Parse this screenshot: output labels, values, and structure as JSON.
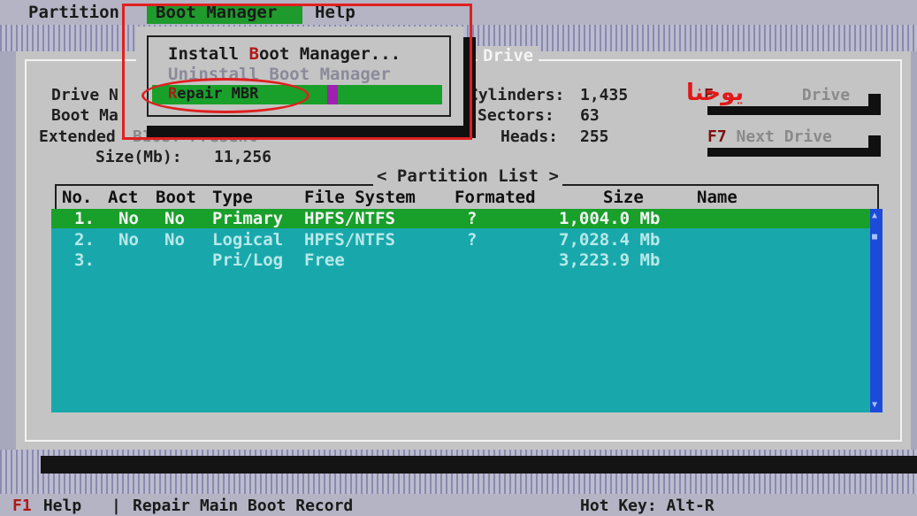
{
  "menubar": {
    "items": [
      {
        "hot": "",
        "label": "Partition"
      },
      {
        "hot": "",
        "label": "Boot Manager"
      },
      {
        "hot": "",
        "label": "Help"
      }
    ]
  },
  "dropdown": {
    "install": {
      "pre": "Install ",
      "hot": "B",
      "post": "oot Manager..."
    },
    "uninstall": "Uninstall Boot Manager",
    "repair": {
      "hot": "R",
      "post": "epair MBR"
    }
  },
  "dialog": {
    "title": "Drive",
    "drive_n_label": "Drive N",
    "boot_ma_label": "Boot Ma",
    "extended_label": "Extended",
    "extended_value": "BIOS: Present",
    "size_label": "Size(Mb):",
    "size_value": "11,256",
    "cylinders_label": "Cylinders:",
    "cylinders_value": "1,435",
    "sectors_label": "Sectors:",
    "sectors_value": "63",
    "heads_label": "Heads:",
    "heads_value": "255",
    "prev_drive": {
      "key": "F",
      "rest": "Drive"
    },
    "next_drive": {
      "key": "F7",
      "rest": " Next Drive"
    }
  },
  "partition_list": {
    "title": "< Partition List >",
    "columns": {
      "no": "No.",
      "act": "Act",
      "boot": "Boot",
      "type": "Type",
      "fs": "File System",
      "formated": "Formated",
      "size": "Size",
      "name": "Name"
    },
    "rows": [
      {
        "no": "1.",
        "act": "No",
        "boot": "No",
        "type": "Primary",
        "fs": "HPFS/NTFS",
        "formated": "?",
        "size": "1,004.0 Mb",
        "name": ""
      },
      {
        "no": "2.",
        "act": "No",
        "boot": "No",
        "type": "Logical",
        "fs": "HPFS/NTFS",
        "formated": "?",
        "size": "7,028.4 Mb",
        "name": ""
      },
      {
        "no": "3.",
        "act": "",
        "boot": "",
        "type": "Pri/Log",
        "fs": "Free",
        "formated": "",
        "size": "3,223.9 Mb",
        "name": ""
      }
    ],
    "selected_index": 0
  },
  "statusbar": {
    "f1_key": "F1",
    "help": " Help",
    "sep": "|",
    "description": "Repair Main Boot Record",
    "hotkey": "Hot Key: Alt-R"
  },
  "watermark": "يوحنا",
  "colors": {
    "background": "#a8a8bc",
    "dialog": "#c4c4c4",
    "list": "#18a8ac",
    "highlight": "#18a02a",
    "scrollbar": "#1b4bd8",
    "annotation": "#e02020"
  }
}
